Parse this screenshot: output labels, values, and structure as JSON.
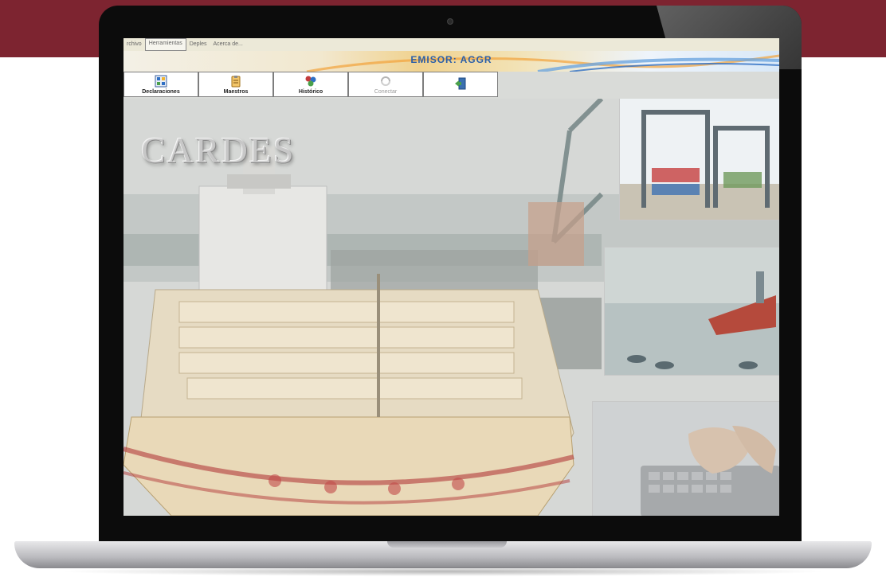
{
  "menu": {
    "items": [
      "rchivo",
      "Herramientas",
      "Deples",
      "Acerca de..."
    ],
    "active_index": 1
  },
  "banner": {
    "title": "EMISOR:  AGGR"
  },
  "toolbar": {
    "buttons": [
      {
        "label": "Declaraciones",
        "icon": "declaraciones-icon",
        "disabled": false
      },
      {
        "label": "Maestros",
        "icon": "clipboard-icon",
        "disabled": false
      },
      {
        "label": "Histórico",
        "icon": "history-icon",
        "disabled": false
      },
      {
        "label": "Conectar",
        "icon": "connect-icon",
        "disabled": true
      },
      {
        "label": "",
        "icon": "exit-door-icon",
        "disabled": false
      }
    ]
  },
  "background": {
    "watermark": "CARDES"
  },
  "colors": {
    "frame": "#7d2430",
    "banner_title": "#2b5fa8",
    "menubar": "#ece9d8"
  }
}
